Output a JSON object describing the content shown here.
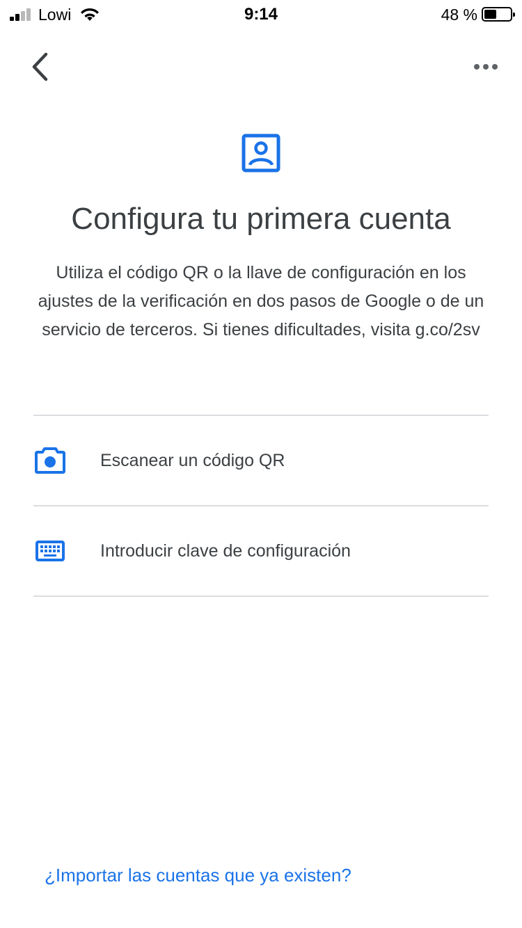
{
  "status_bar": {
    "carrier": "Lowi",
    "time": "9:14",
    "battery_percent": "48 %",
    "battery_level": 0.48
  },
  "nav": {
    "back_icon": "chevron-left-icon",
    "more_icon": "more-horizontal-icon"
  },
  "header": {
    "icon": "account-box-icon",
    "title": "Configura tu primera cuenta",
    "description": "Utiliza el código QR o la llave de configuración en los ajustes de la verificación en dos pasos de Google o de un servicio de terceros. Si tienes dificultades, visita g.co/2sv"
  },
  "options": [
    {
      "icon": "camera-icon",
      "label": "Escanear un código QR"
    },
    {
      "icon": "keyboard-icon",
      "label": "Introducir clave de configuración"
    }
  ],
  "footer": {
    "import_link": "¿Importar las cuentas que ya existen?"
  },
  "colors": {
    "accent": "#1a73e8",
    "text": "#3c4043",
    "divider": "#dadce0"
  }
}
